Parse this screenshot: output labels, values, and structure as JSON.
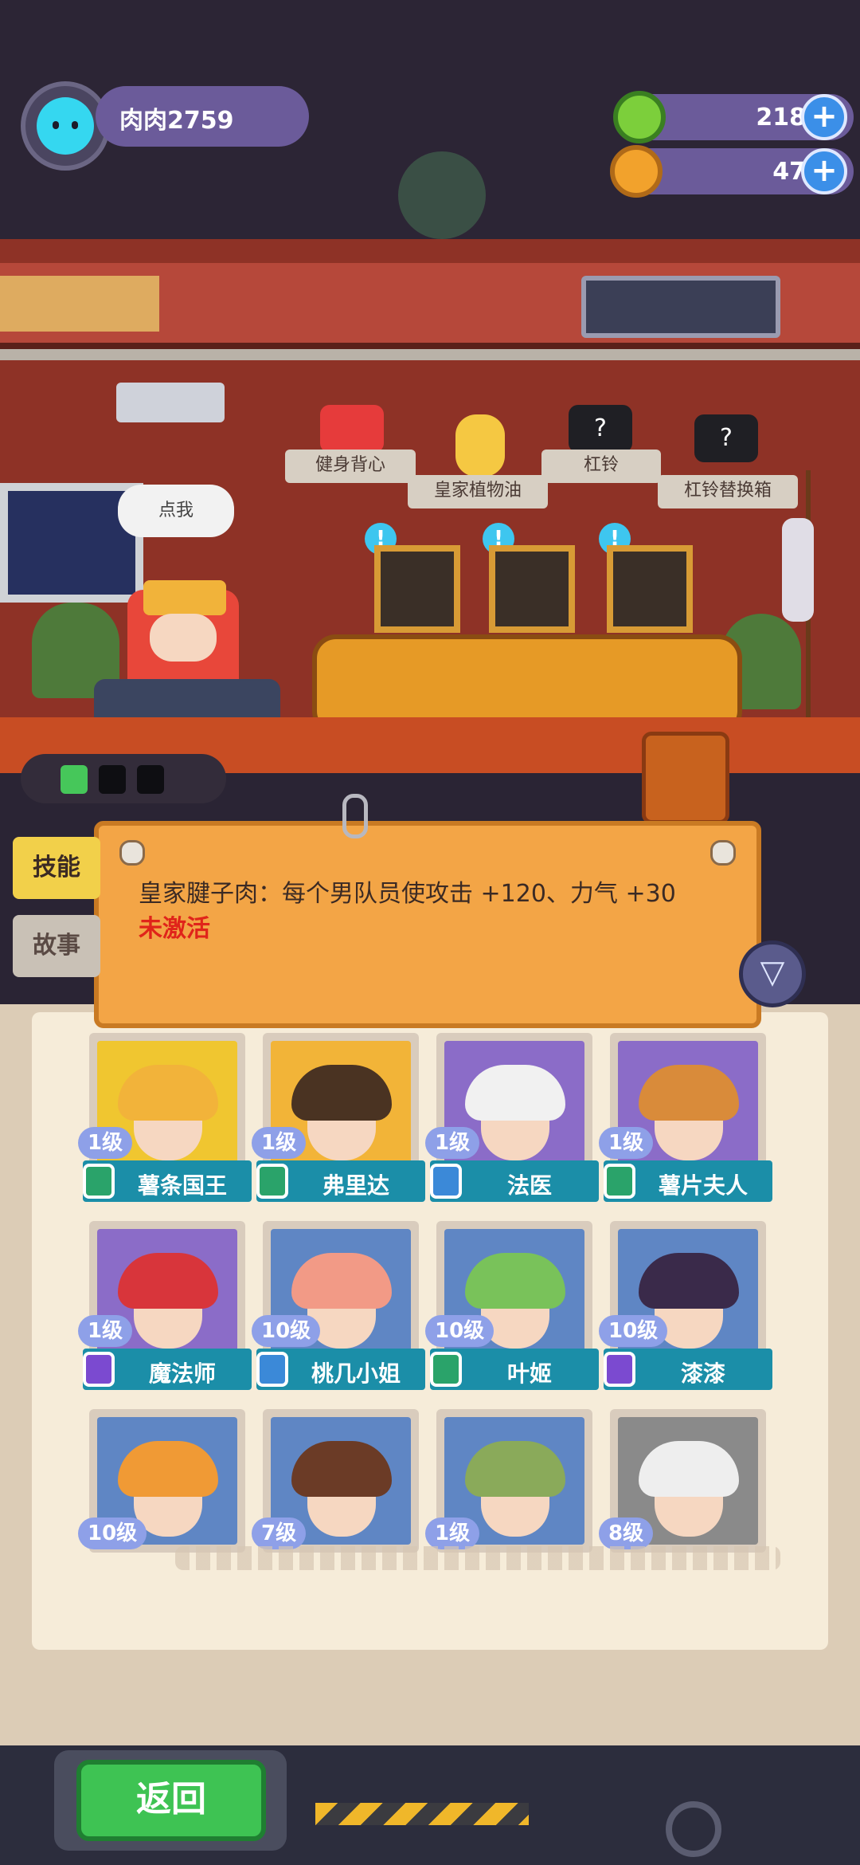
{
  "player": {
    "name": "肉肉2759"
  },
  "currency": [
    {
      "name": "donut",
      "value": "218",
      "icon": "green-donut-icon",
      "color": "#7ccf3b"
    },
    {
      "name": "planet",
      "value": "47",
      "icon": "orange-planet-icon",
      "color": "#f2a22c"
    }
  ],
  "shelf": {
    "speech": "点我",
    "items": [
      {
        "label": "健身背心",
        "icon": "tank-top-icon"
      },
      {
        "label": "皇家植物油",
        "icon": "oil-bottle-icon"
      },
      {
        "label": "杠铃",
        "icon": "barbell-icon"
      },
      {
        "label": "杠铃替换箱",
        "icon": "barbell-box-icon"
      }
    ]
  },
  "tabs": {
    "skill": "技能",
    "story": "故事"
  },
  "skill": {
    "text": "皇家腱子肉：每个男队员使攻击 +120、力气 +30",
    "status": "未激活"
  },
  "characters": [
    {
      "level": "1级",
      "name": "薯条国王",
      "bg": "#f0c630",
      "hair": "#f2b33a",
      "rank": "#2aa36a"
    },
    {
      "level": "1级",
      "name": "弗里达",
      "bg": "#f2b438",
      "hair": "#4a3322",
      "rank": "#2aa36a"
    },
    {
      "level": "1级",
      "name": "法医",
      "bg": "#8b6cc8",
      "hair": "#f1f1f1",
      "rank": "#3b89d8"
    },
    {
      "level": "1级",
      "name": "薯片夫人",
      "bg": "#8b6cc8",
      "hair": "#d98b3a",
      "rank": "#2aa36a"
    },
    {
      "level": "1级",
      "name": "魔法师",
      "bg": "#8b6cc8",
      "hair": "#d8353b",
      "rank": "#7b4ad0"
    },
    {
      "level": "10级",
      "name": "桃几小姐",
      "bg": "#5f86c4",
      "hair": "#f29a86",
      "rank": "#3b89d8"
    },
    {
      "level": "10级",
      "name": "叶姬",
      "bg": "#5f86c4",
      "hair": "#79c25a",
      "rank": "#2aa36a"
    },
    {
      "level": "10级",
      "name": "漆漆",
      "bg": "#5f86c4",
      "hair": "#3a2a4a",
      "rank": "#7b4ad0"
    },
    {
      "level": "10级",
      "name": "",
      "bg": "#5f86c4",
      "hair": "#f09a35",
      "rank": ""
    },
    {
      "level": "7级",
      "name": "",
      "bg": "#5f86c4",
      "hair": "#6b3b26",
      "rank": ""
    },
    {
      "level": "1级",
      "name": "",
      "bg": "#5f86c4",
      "hair": "#8aaa5a",
      "rank": ""
    },
    {
      "level": "8级",
      "name": "",
      "bg": "#8a8a8a",
      "hair": "#eeeeee",
      "rank": ""
    }
  ],
  "footer": {
    "back": "返回"
  }
}
